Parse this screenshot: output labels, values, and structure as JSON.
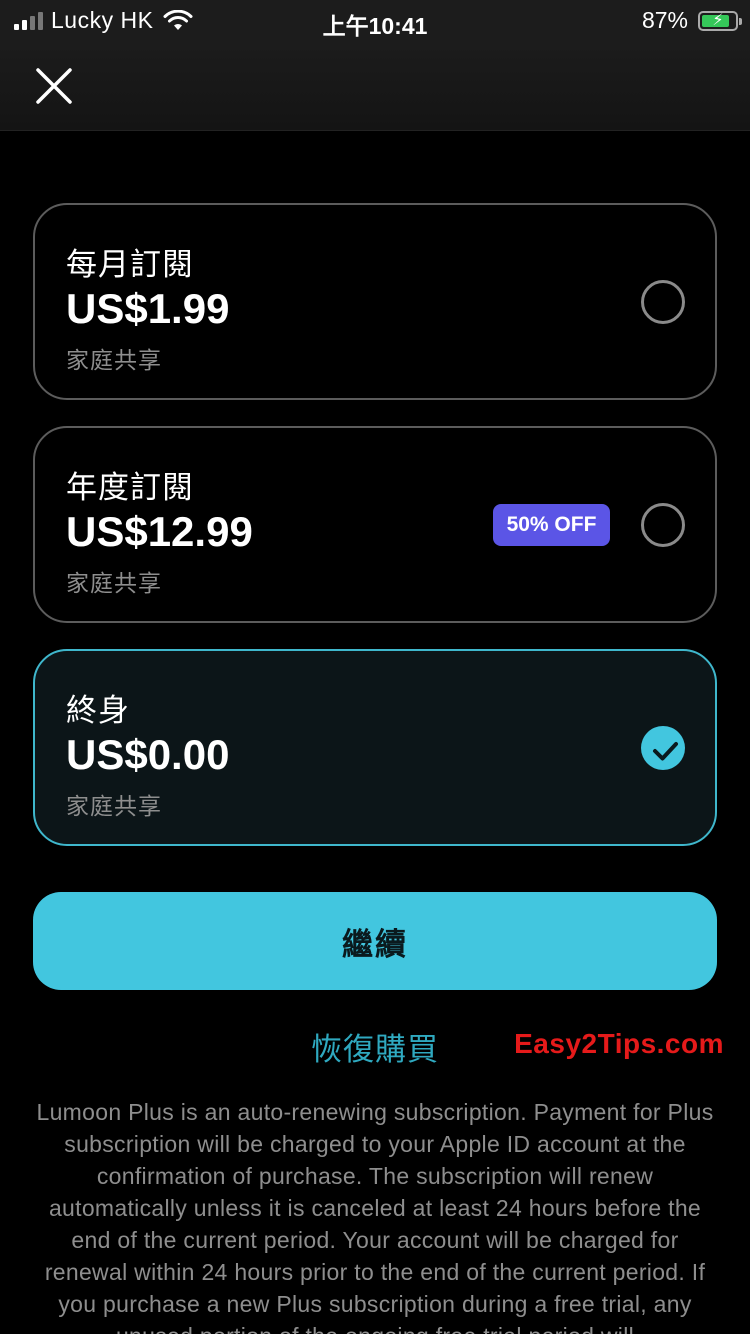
{
  "status_bar": {
    "carrier": "Lucky HK",
    "time": "上午10:41",
    "battery_percent": "87%",
    "battery_level": 0.87
  },
  "nav": {
    "close_icon": "close-icon"
  },
  "plans": [
    {
      "name": "每月訂閱",
      "price": "US$1.99",
      "note": "家庭共享",
      "selected": false
    },
    {
      "name": "年度訂閱",
      "price": "US$12.99",
      "note": "家庭共享",
      "badge": "50% OFF",
      "selected": false
    },
    {
      "name": "終身",
      "price": "US$0.00",
      "note": "家庭共享",
      "selected": true
    }
  ],
  "continue_label": "繼續",
  "restore_label": "恢復購買",
  "watermark": "Easy2Tips.com",
  "terms": "Lumoon Plus is an auto-renewing subscription. Payment for Plus subscription will be charged to your Apple ID account at the confirmation of purchase. The subscription will renew automatically unless it is canceled at least 24 hours before the end of the current period. Your account will be charged for renewal within 24 hours prior to the end of the current period. If you purchase a new Plus subscription during a free trial, any unused portion of the ongoing free trial period will",
  "colors": {
    "accent": "#42c6df",
    "badge": "#5b55e6",
    "restore_link": "#2fa9c0",
    "watermark": "#e51a1a",
    "battery": "#35c759"
  }
}
